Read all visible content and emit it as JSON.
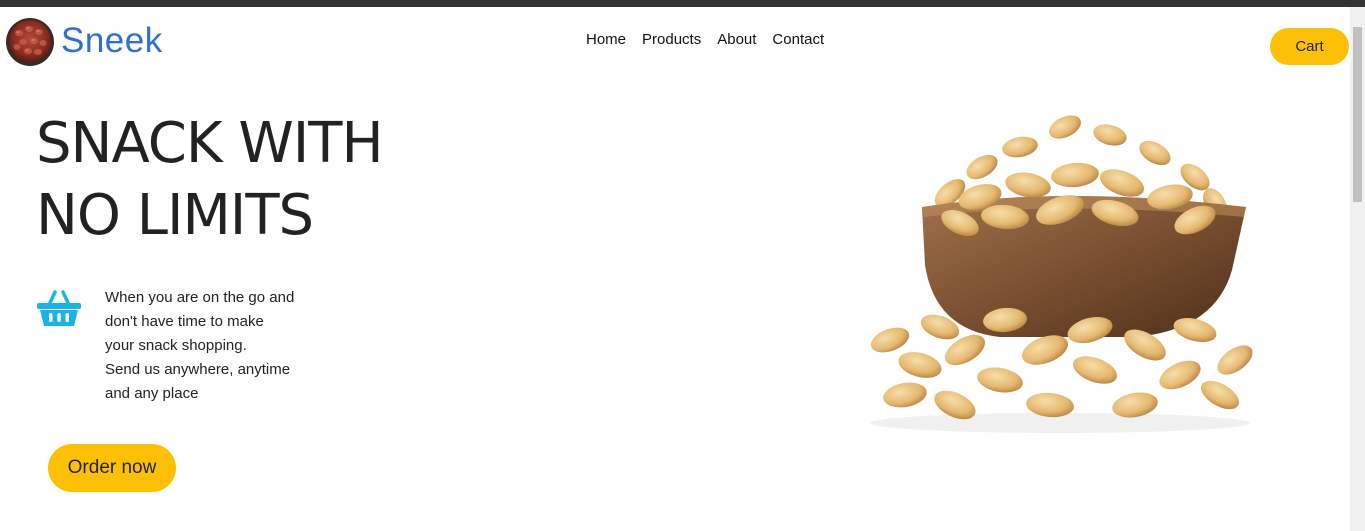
{
  "colors": {
    "brand": "#2f6fd1",
    "accent": "#fec006",
    "icon": "#1ab3e8",
    "topbar": "#333333"
  },
  "header": {
    "logo_icon": "peanut-bowl-logo",
    "brand": "Sneek",
    "nav": [
      "Home",
      "Products",
      "About",
      "Contact"
    ],
    "cart_label": "Cart"
  },
  "hero": {
    "title_lines": [
      "SNACK WITH",
      "NO LIMITS"
    ],
    "icon": "basket-icon",
    "description_lines": [
      "When you are on the go and",
      "don't have time to make",
      "your snack shopping.",
      "Send us anywhere, anytime",
      "and any place"
    ],
    "order_label": "Order now",
    "image": "peanuts-bowl-image"
  }
}
